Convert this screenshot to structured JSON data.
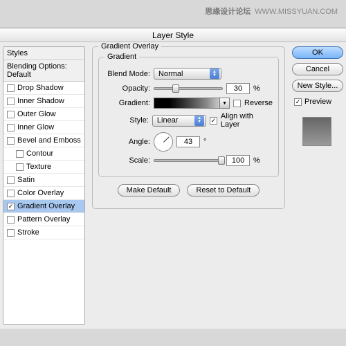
{
  "watermark": {
    "cn": "思缘设计论坛",
    "url": "WWW.MISSYUAN.COM"
  },
  "title": "Layer Style",
  "left": {
    "header": "Styles",
    "blending": "Blending Options: Default",
    "items": [
      {
        "label": "Drop Shadow",
        "checked": false,
        "indent": false
      },
      {
        "label": "Inner Shadow",
        "checked": false,
        "indent": false
      },
      {
        "label": "Outer Glow",
        "checked": false,
        "indent": false
      },
      {
        "label": "Inner Glow",
        "checked": false,
        "indent": false
      },
      {
        "label": "Bevel and Emboss",
        "checked": false,
        "indent": false
      },
      {
        "label": "Contour",
        "checked": false,
        "indent": true
      },
      {
        "label": "Texture",
        "checked": false,
        "indent": true
      },
      {
        "label": "Satin",
        "checked": false,
        "indent": false
      },
      {
        "label": "Color Overlay",
        "checked": false,
        "indent": false
      },
      {
        "label": "Gradient Overlay",
        "checked": true,
        "indent": false,
        "active": true
      },
      {
        "label": "Pattern Overlay",
        "checked": false,
        "indent": false
      },
      {
        "label": "Stroke",
        "checked": false,
        "indent": false
      }
    ]
  },
  "center": {
    "outer_legend": "Gradient Overlay",
    "inner_legend": "Gradient",
    "blend_label": "Blend Mode:",
    "blend_value": "Normal",
    "opacity_label": "Opacity:",
    "opacity_value": "30",
    "gradient_label": "Gradient:",
    "reverse_label": "Reverse",
    "style_label": "Style:",
    "style_value": "Linear",
    "align_label": "Align with Layer",
    "angle_label": "Angle:",
    "angle_value": "43",
    "scale_label": "Scale:",
    "scale_value": "100",
    "percent": "%",
    "degree": "°",
    "make_default": "Make Default",
    "reset_default": "Reset to Default"
  },
  "right": {
    "ok": "OK",
    "cancel": "Cancel",
    "new_style": "New Style...",
    "preview": "Preview"
  }
}
